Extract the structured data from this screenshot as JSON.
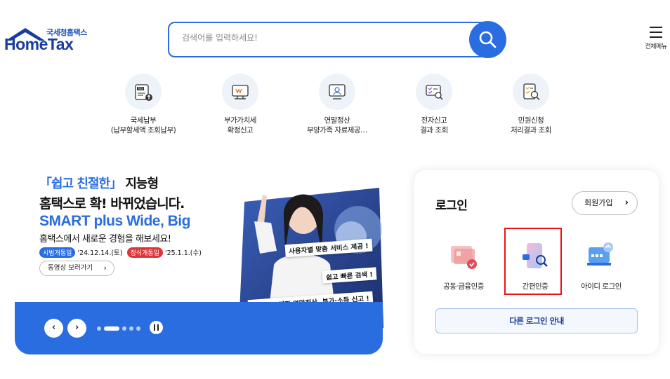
{
  "header": {
    "logo_sub": "국세청홈택스",
    "logo_main": "HomeTax",
    "search_placeholder": "검색어를 입력하세요!",
    "menu_label": "전체메뉴"
  },
  "quick_menu": [
    {
      "icon": "tax-payment-icon",
      "line1": "국세납부",
      "line2": "(납부할세액 조회납부)"
    },
    {
      "icon": "vat-report-icon",
      "line1": "부가가치세",
      "line2": "확정신고"
    },
    {
      "icon": "year-end-settlement-icon",
      "line1": "연말정산",
      "line2": "부양가족 자료제공…"
    },
    {
      "icon": "e-filing-result-icon",
      "line1": "전자신고",
      "line2": "결과 조회"
    },
    {
      "icon": "civil-petition-icon",
      "line1": "민원신청",
      "line2": "처리결과 조회"
    }
  ],
  "banner": {
    "headline1_bracket": "「쉽고 친절한」",
    "headline1_rest": " 지능형",
    "headline2": "홈택스로 확! 바뀌었습니다.",
    "headline3": "SMART plus Wide, Big",
    "headline4": "홈택스에서 새로운 경험을 해보세요!",
    "pill1": "시범개통일",
    "date1": "'24.12.14.(토)",
    "pill2": "정식개통일",
    "date2": "'25.1.1.(수)",
    "video_button": "동영상 보러가기",
    "tag1": "사용자별 맞춤 서비스 제공 !",
    "tag2": "쉽고 빠른 검색 !",
    "tag3": "더 스마트해진 연말정산, 부가·소득 신고 !"
  },
  "slider": {
    "prev": "‹",
    "next": "›",
    "dot_count": 5,
    "active_index": 1
  },
  "login": {
    "title": "로그인",
    "join_button": "회원가입",
    "options": [
      {
        "icon": "certificate-icon",
        "label": "공동·금융인증"
      },
      {
        "icon": "simple-auth-icon",
        "label": "간편인증"
      },
      {
        "icon": "id-login-icon",
        "label": "아이디 로그인"
      }
    ],
    "other_login": "다른 로그인 안내"
  },
  "colors": {
    "primary": "#2a6de0",
    "navy": "#1a3c9c",
    "highlight": "#ee1111",
    "red_pill": "#e0343a"
  }
}
